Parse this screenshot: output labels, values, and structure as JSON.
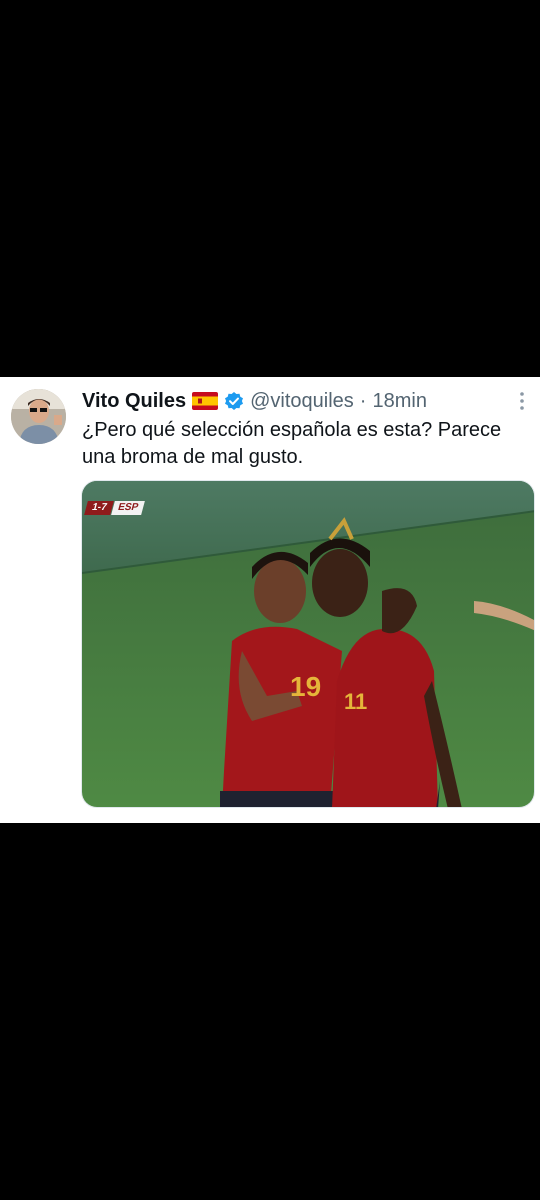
{
  "tweet": {
    "author_name": "Vito Quiles",
    "flag_icon": "spain-flag-icon",
    "verified_icon": "verified-badge-icon",
    "handle": "@vitoquiles",
    "separator": "·",
    "time": "18min",
    "more_icon": "more-options-icon",
    "text": "¿Pero qué selección española es esta? Parece una broma de mal gusto.",
    "media": {
      "scorebug_score": "1-7",
      "scorebug_team": "ESP",
      "jersey_left": "19",
      "jersey_right": "11"
    }
  },
  "colors": {
    "background": "#000000",
    "card": "#ffffff",
    "name": "#0f1419",
    "meta": "#536471",
    "verified": "#1d9bf0",
    "spain_red": "#8e1b1b"
  }
}
